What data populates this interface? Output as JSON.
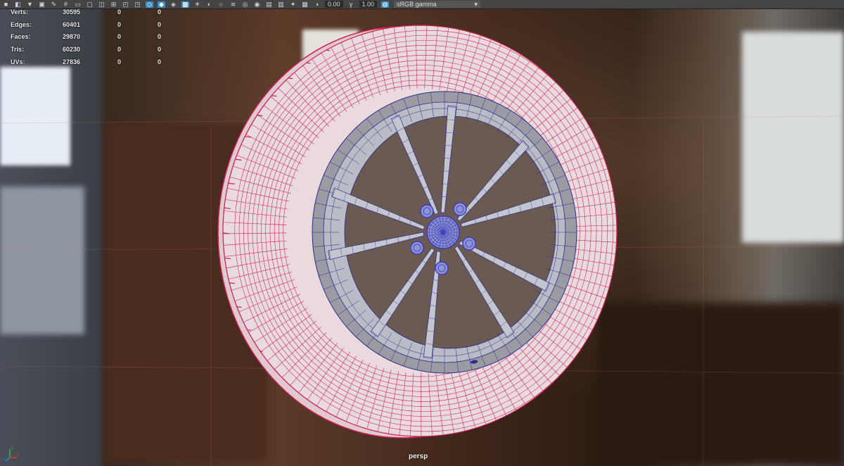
{
  "toolbar": {
    "icons": [
      "camera-icon",
      "camera-attr-icon",
      "bookmark-icon",
      "image-plane-icon",
      "pencil-icon",
      "grid-icon",
      "film-gate-icon",
      "resolution-gate-icon",
      "gate-mask-icon",
      "field-chart-icon",
      "safe-action-icon",
      "safe-title-icon",
      "wireframe-icon",
      "smooth-shade-icon",
      "default-material-icon",
      "textured-icon",
      "lights-icon",
      "shadows-icon",
      "ambient-occlusion-icon",
      "motion-blur-icon",
      "anti-alias-icon",
      "depth-of-field-icon",
      "isolate-select-icon",
      "xray-icon",
      "xray-joints-icon",
      "xray-components-icon",
      "exposure-icon",
      "gamma-icon",
      "color-management-icon"
    ],
    "exposure_value": "0.00",
    "gamma_value": "1.00",
    "view_transform": "sRGB gamma"
  },
  "hud": {
    "rows": [
      {
        "label": "Verts:",
        "total": "30595",
        "selected": "0",
        "highlighted": "0"
      },
      {
        "label": "Edges:",
        "total": "60401",
        "selected": "0",
        "highlighted": "0"
      },
      {
        "label": "Faces:",
        "total": "29870",
        "selected": "0",
        "highlighted": "0"
      },
      {
        "label": "Tris:",
        "total": "60230",
        "selected": "0",
        "highlighted": "0"
      },
      {
        "label": "UVs:",
        "total": "27836",
        "selected": "0",
        "highlighted": "0"
      }
    ]
  },
  "camera_label": "persp",
  "axis": {
    "z": "z",
    "x": "x",
    "y": "y"
  },
  "colors": {
    "tire_wire": "#c81e50",
    "rim_wire": "#2a2a8a",
    "rim_fill": "#b9bcc4",
    "tire_fill": "#e9d8dc",
    "hub": "#3b3bb8"
  }
}
